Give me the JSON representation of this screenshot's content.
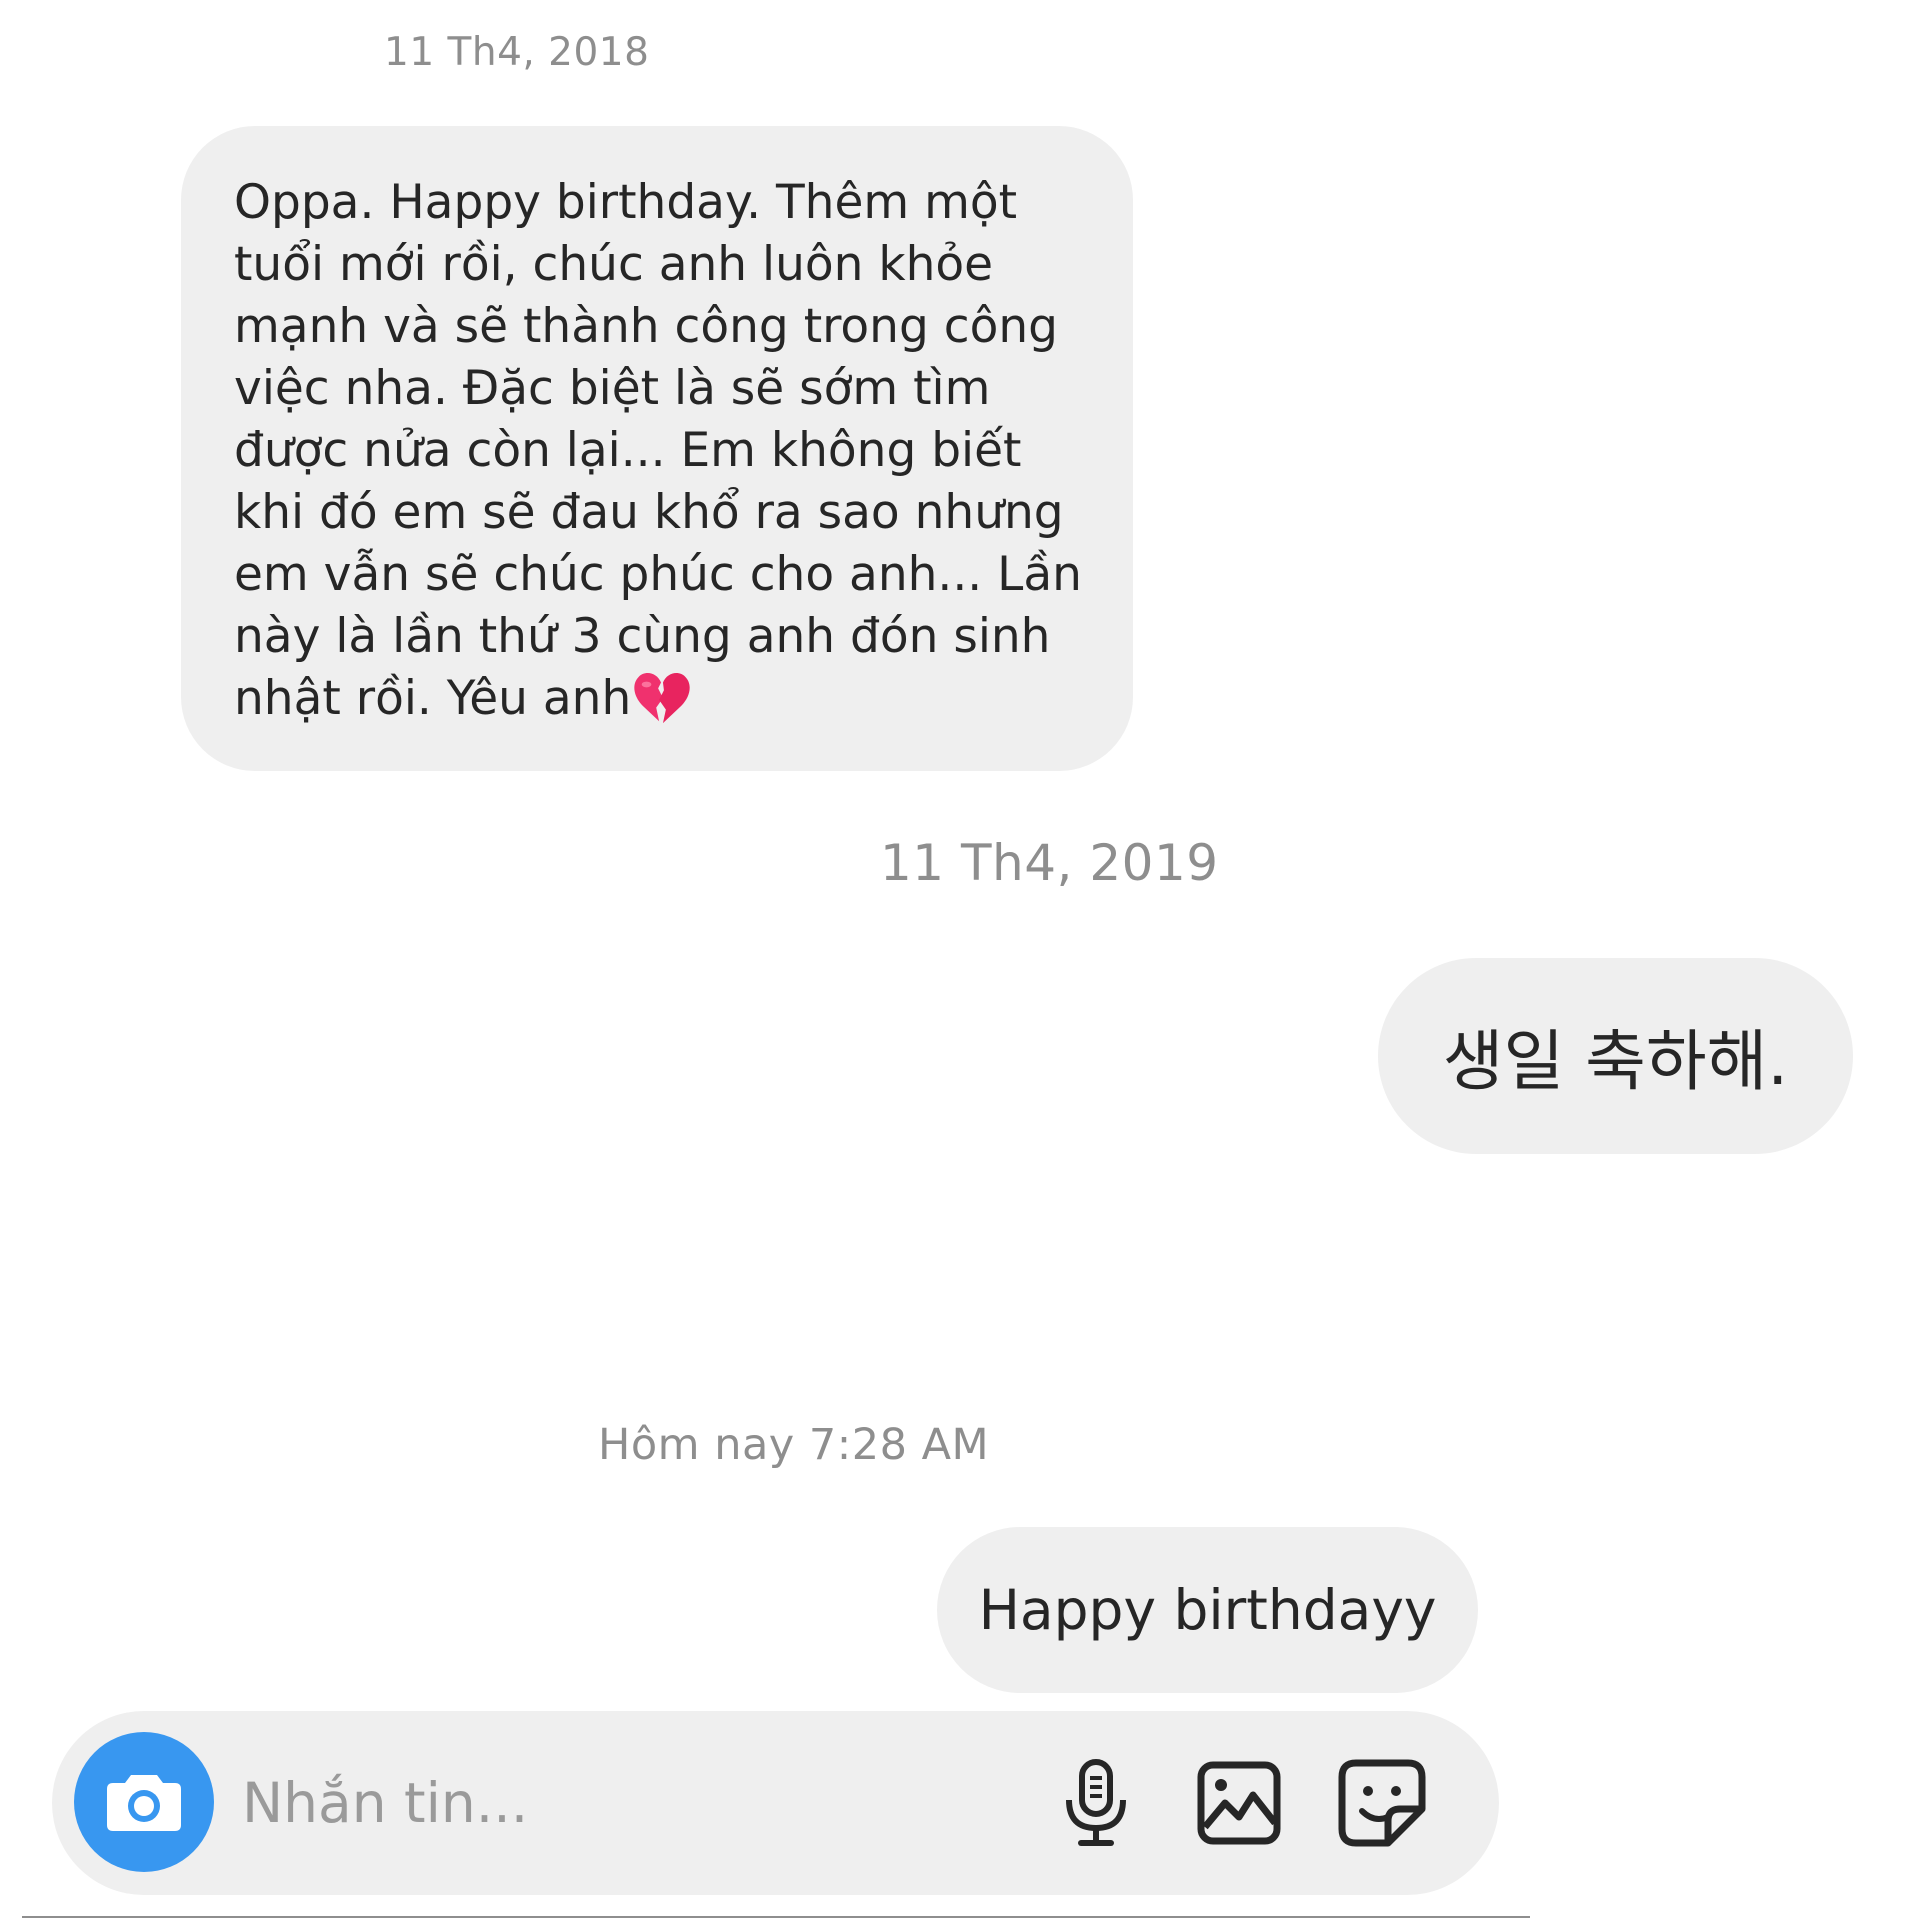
{
  "timestamps": {
    "first": "11 Th4, 2018",
    "second": "11 Th4, 2019",
    "third": "Hôm nay 7:28 AM"
  },
  "messages": [
    {
      "lines": [
        "Oppa. Happy birthday. Thêm một",
        "tuổi mới rồi, chúc anh luôn khỏe",
        "mạnh và sẽ thành công trong công",
        "việc nha. Đặc biệt là sẽ sớm tìm",
        "được nửa còn lại... Em không biết",
        "khi đó em sẽ đau khổ ra sao nhưng",
        "em vẫn sẽ chúc phúc cho anh... Lần",
        "này là lần thứ 3 cùng anh đón sinh",
        "nhật rồi. Yêu anh"
      ],
      "emoji": "broken-heart-emoji"
    },
    {
      "text": "생일 축하해."
    },
    {
      "text": "Happy birthdayy"
    }
  ],
  "composer": {
    "placeholder": "Nhắn tin...",
    "value": "",
    "camera_icon": "camera-icon",
    "mic_icon": "microphone-icon",
    "gallery_icon": "image-icon",
    "sticker_icon": "sticker-icon"
  },
  "colors": {
    "bubble_bg": "#efefef",
    "camera_accent": "#3897f0",
    "timestamp_text": "#8e8e8e",
    "heart_pink": "#f0316e"
  }
}
